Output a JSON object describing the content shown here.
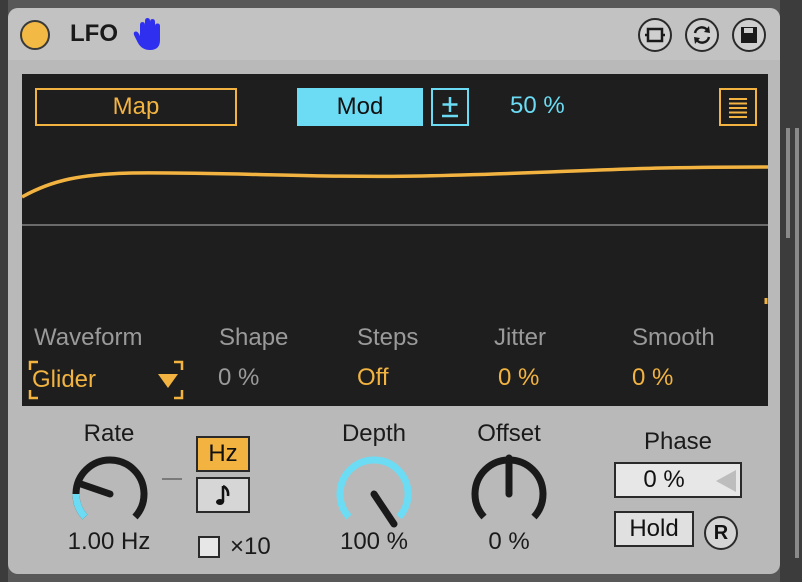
{
  "device": {
    "title": "LFO",
    "icons": [
      "power-toggle",
      "hand-icon",
      "device-icon",
      "refresh-icon",
      "save-icon"
    ]
  },
  "display": {
    "map_label": "Map",
    "mod_label": "Mod",
    "plusminus_label": "±",
    "mod_amount": "50 %",
    "waveform_points": [
      0.6,
      0.45,
      0.42,
      0.44,
      0.45,
      0.43,
      0.41,
      0.4,
      0.39
    ]
  },
  "params": {
    "waveform": {
      "label": "Waveform",
      "value": "Glider"
    },
    "shape": {
      "label": "Shape",
      "value": "0 %"
    },
    "steps": {
      "label": "Steps",
      "value": "Off"
    },
    "jitter": {
      "label": "Jitter",
      "value": "0 %"
    },
    "smooth": {
      "label": "Smooth",
      "value": "0 %"
    }
  },
  "controls": {
    "rate": {
      "label": "Rate",
      "value": "1.00 Hz",
      "hz_label": "Hz",
      "note_label": "♪",
      "x10_label": "×10"
    },
    "depth": {
      "label": "Depth",
      "value": "100 %",
      "level": 1.0
    },
    "offset": {
      "label": "Offset",
      "value": "0 %",
      "level": 0.5
    },
    "phase": {
      "label": "Phase",
      "value": "0 %"
    },
    "hold_label": "Hold",
    "r_label": "R"
  },
  "colors": {
    "accent_orange": "#f2b341",
    "accent_cyan": "#6bdcf4",
    "display_bg": "#1e1e1e"
  }
}
